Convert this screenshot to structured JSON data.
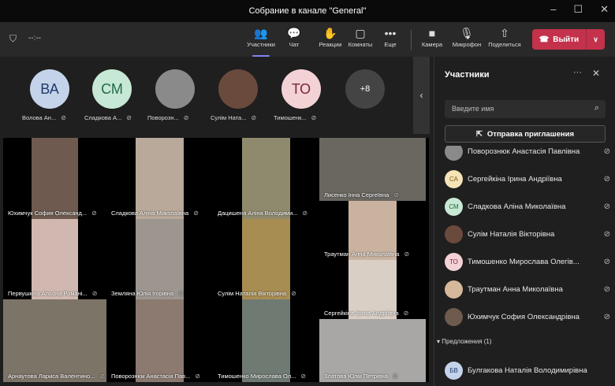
{
  "window": {
    "title": "Собрание в канале \"General\"",
    "controls": [
      "–",
      "☐",
      "✕"
    ]
  },
  "toolbar": {
    "timer": "--:--",
    "buttons": [
      {
        "label": "Участники",
        "icon": "people-icon",
        "glyph": "👥",
        "active": true
      },
      {
        "label": "Чат",
        "icon": "chat-icon",
        "glyph": "💬"
      },
      {
        "label": "Реакции",
        "icon": "hand-icon",
        "glyph": "✋"
      },
      {
        "label": "Комнаты",
        "icon": "rooms-icon",
        "glyph": "▢"
      },
      {
        "label": "Еще",
        "icon": "more-icon",
        "glyph": "•••"
      },
      {
        "label": "Камера",
        "icon": "camera-icon",
        "glyph": "■"
      },
      {
        "label": "Микрофон",
        "icon": "microphone-icon",
        "glyph": "🎙"
      },
      {
        "label": "Поделиться",
        "icon": "share-icon",
        "glyph": "⇧"
      }
    ],
    "leave_label": "Выйти",
    "leave_color": "#c4314b"
  },
  "strip": {
    "avatars": [
      {
        "initials": "ВА",
        "name": "Волова Ан...",
        "bg": "#c5d3ea",
        "fg": "#1f3a6b"
      },
      {
        "initials": "СМ",
        "name": "Сладкова А...",
        "bg": "#c7e8d4",
        "fg": "#226a43"
      },
      {
        "initials": "",
        "name": "Поворозн...",
        "bg": "#8a8a8a",
        "fg": "#fff"
      },
      {
        "initials": "",
        "name": "Сулім Ната...",
        "bg": "#6b4a3e",
        "fg": "#fff"
      },
      {
        "initials": "ТО",
        "name": "Тимошенк...",
        "bg": "#f3d2d6",
        "fg": "#7a2633"
      }
    ],
    "overflow": "+8"
  },
  "grid": {
    "tiles": [
      {
        "name": "Юхимчук София Олександ...",
        "color": "#6e5a4e"
      },
      {
        "name": "Сладкова Аліна Миколаївна",
        "color": "#b8a99a"
      },
      {
        "name": "Дацишена Аліна Володими...",
        "color": "#8f8a6d"
      },
      {
        "name": "Лисенко Інна Сергеївна",
        "color": "#6a6660"
      },
      {
        "name": "Первушкіна Альона Романі...",
        "color": "#d0b8b0"
      },
      {
        "name": "Земляна Юлія Ігорівна",
        "color": "#9d9690"
      },
      {
        "name": "Сулім Наталія Вікторівна",
        "color": "#a88d52"
      },
      {
        "name": "Траутман Анна Миколаївна",
        "color": "#c9b3a0"
      },
      {
        "name": "Сергейкіна Ірина Андріївна",
        "color": "#d9cfc5"
      },
      {
        "name": "Арнаутова Лариса Валентино...",
        "color": "#7d7468"
      },
      {
        "name": "Поворознюк Анастасія Пав...",
        "color": "#8c7a70"
      },
      {
        "name": "Тимошенко Мирослава Ол...",
        "color": "#6f7a73"
      },
      {
        "name": "Златова Юлія Петрівна",
        "color": "#a9a7a5"
      }
    ]
  },
  "panel": {
    "title": "Участники",
    "search_placeholder": "Введите имя",
    "invite_label": "Отправка приглашения",
    "participants": [
      {
        "initials": "",
        "name": "Поворознюк Анастасія Павлівна",
        "bg": "#8a8a8a"
      },
      {
        "initials": "СА",
        "name": "Сергейкіна Ірина Андріївна",
        "bg": "#f5e3b8",
        "fg": "#7a5a10"
      },
      {
        "initials": "СМ",
        "name": "Сладкова Аліна Миколаївна",
        "bg": "#c7e8d4",
        "fg": "#226a43"
      },
      {
        "initials": "",
        "name": "Сулім Наталія Вікторівна",
        "bg": "#6b4a3e"
      },
      {
        "initials": "ТО",
        "name": "Тимошенко Мирослава Олегів...",
        "bg": "#f3d2d6",
        "fg": "#7a2633"
      },
      {
        "initials": "",
        "name": "Траутман Анна Миколаївна",
        "bg": "#d6b89a"
      },
      {
        "initials": "",
        "name": "Юхимчук София Олександрівна",
        "bg": "#6e5a4e"
      }
    ],
    "suggestions_label": "Предложения (1)",
    "suggestions": [
      {
        "initials": "БВ",
        "name": "Булгакова Наталія Володимирівна",
        "bg": "#c5d3ea",
        "fg": "#1f3a6b"
      }
    ]
  }
}
